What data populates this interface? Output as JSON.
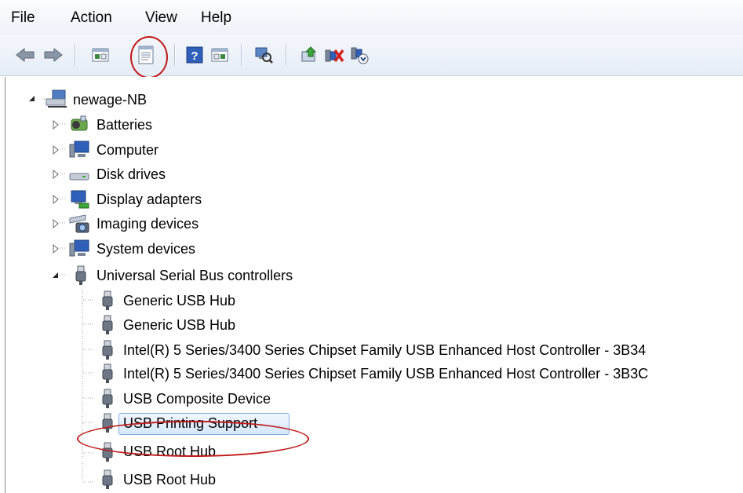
{
  "menu": {
    "file": "File",
    "action": "Action",
    "view": "View",
    "help": "Help"
  },
  "toolbar": {
    "buttons": [
      "back-icon",
      "forward-icon",
      "show-hide-console-tree-icon",
      "properties-icon",
      "help-icon",
      "show-action-pane-icon",
      "scan-hardware-changes-icon",
      "update-driver-icon",
      "disable-device-icon",
      "uninstall-device-icon"
    ]
  },
  "tree": {
    "root": "newage-NB",
    "categories": [
      {
        "label": "Batteries",
        "icon": "battery-icon"
      },
      {
        "label": "Computer",
        "icon": "computer-icon"
      },
      {
        "label": "Disk drives",
        "icon": "disk-drive-icon"
      },
      {
        "label": "Display adapters",
        "icon": "display-adapter-icon"
      },
      {
        "label": "Imaging devices",
        "icon": "camera-icon"
      },
      {
        "label": "System devices",
        "icon": "computer-icon"
      },
      {
        "label": "Universal Serial Bus controllers",
        "icon": "usb-plug-icon"
      }
    ],
    "usb_children": [
      "Generic USB Hub",
      "Generic USB Hub",
      "Intel(R) 5 Series/3400 Series Chipset Family USB Enhanced Host Controller - 3B34",
      "Intel(R) 5 Series/3400 Series Chipset Family USB Enhanced Host Controller - 3B3C",
      "USB Composite Device",
      "USB Printing Support",
      "USB Root Hub",
      "USB Root Hub"
    ],
    "selected": "USB Printing Support"
  },
  "colors": {
    "annotation": "#c11a1a",
    "selection": "#d5e8fc",
    "selection_border": "#84acdd"
  }
}
